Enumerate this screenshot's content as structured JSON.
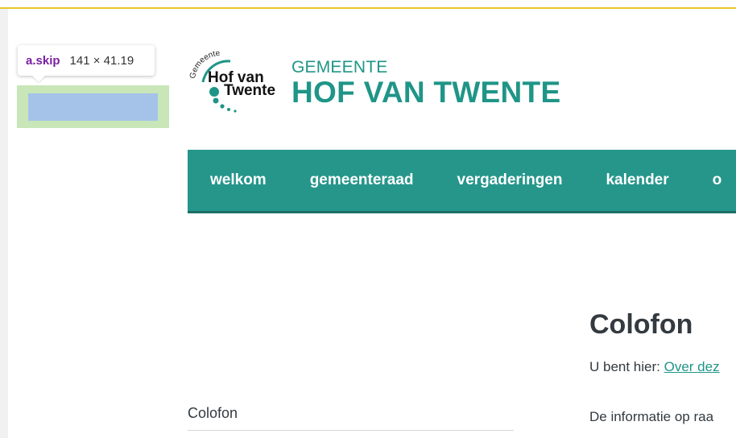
{
  "devtools": {
    "selector": "a.skip",
    "size": "141 × 41.19"
  },
  "logo": {
    "arc_text": "Gemeente",
    "line1": "Hof van",
    "line2": "Twente"
  },
  "brand": {
    "small": "GEMEENTE",
    "large": "HOF VAN TWENTE"
  },
  "nav": {
    "items": [
      {
        "label": "welkom"
      },
      {
        "label": "gemeenteraad"
      },
      {
        "label": "vergaderingen"
      },
      {
        "label": "kalender"
      },
      {
        "label": "o"
      }
    ]
  },
  "page": {
    "title": "Colofon",
    "breadcrumb_prefix": "U bent hier:",
    "breadcrumb_link": "Over dez",
    "intro_text": "De informatie op raa"
  },
  "sidebar": {
    "items": [
      {
        "label": "Colofon"
      }
    ]
  },
  "colors": {
    "accent": "#1f9587",
    "nav_bg": "#26968b",
    "top_border": "#e6c62b"
  }
}
